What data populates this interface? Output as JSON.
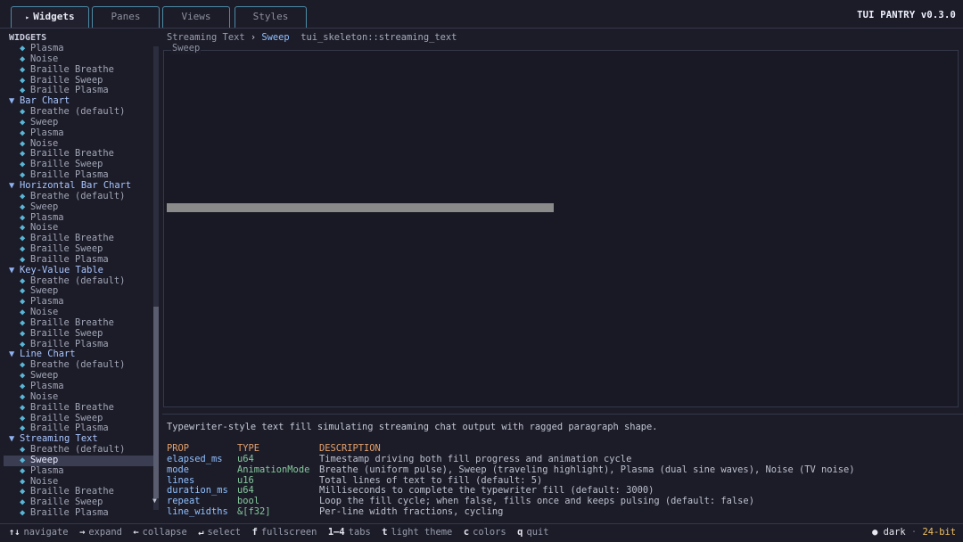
{
  "app": {
    "brand": "TUI PANTRY v0.3.0"
  },
  "tabs": [
    {
      "label": "Widgets",
      "active": true,
      "arrow": "▸"
    },
    {
      "label": "Panes",
      "active": false
    },
    {
      "label": "Views",
      "active": false
    },
    {
      "label": "Styles",
      "active": false
    }
  ],
  "sidebar": {
    "title": "WIDGETS",
    "rows": [
      {
        "kind": "item",
        "label": "Plasma"
      },
      {
        "kind": "item",
        "label": "Noise"
      },
      {
        "kind": "item",
        "label": "Braille Breathe"
      },
      {
        "kind": "item",
        "label": "Braille Sweep"
      },
      {
        "kind": "item",
        "label": "Braille Plasma"
      },
      {
        "kind": "group",
        "label": "Bar Chart"
      },
      {
        "kind": "item",
        "label": "Breathe (default)"
      },
      {
        "kind": "item",
        "label": "Sweep"
      },
      {
        "kind": "item",
        "label": "Plasma"
      },
      {
        "kind": "item",
        "label": "Noise"
      },
      {
        "kind": "item",
        "label": "Braille Breathe"
      },
      {
        "kind": "item",
        "label": "Braille Sweep"
      },
      {
        "kind": "item",
        "label": "Braille Plasma"
      },
      {
        "kind": "group",
        "label": "Horizontal Bar Chart"
      },
      {
        "kind": "item",
        "label": "Breathe (default)"
      },
      {
        "kind": "item",
        "label": "Sweep"
      },
      {
        "kind": "item",
        "label": "Plasma"
      },
      {
        "kind": "item",
        "label": "Noise"
      },
      {
        "kind": "item",
        "label": "Braille Breathe"
      },
      {
        "kind": "item",
        "label": "Braille Sweep"
      },
      {
        "kind": "item",
        "label": "Braille Plasma"
      },
      {
        "kind": "group",
        "label": "Key-Value Table"
      },
      {
        "kind": "item",
        "label": "Breathe (default)"
      },
      {
        "kind": "item",
        "label": "Sweep"
      },
      {
        "kind": "item",
        "label": "Plasma"
      },
      {
        "kind": "item",
        "label": "Noise"
      },
      {
        "kind": "item",
        "label": "Braille Breathe"
      },
      {
        "kind": "item",
        "label": "Braille Sweep"
      },
      {
        "kind": "item",
        "label": "Braille Plasma"
      },
      {
        "kind": "group",
        "label": "Line Chart"
      },
      {
        "kind": "item",
        "label": "Breathe (default)"
      },
      {
        "kind": "item",
        "label": "Sweep"
      },
      {
        "kind": "item",
        "label": "Plasma"
      },
      {
        "kind": "item",
        "label": "Noise"
      },
      {
        "kind": "item",
        "label": "Braille Breathe"
      },
      {
        "kind": "item",
        "label": "Braille Sweep"
      },
      {
        "kind": "item",
        "label": "Braille Plasma"
      },
      {
        "kind": "group",
        "label": "Streaming Text"
      },
      {
        "kind": "item",
        "label": "Breathe (default)"
      },
      {
        "kind": "item",
        "label": "Sweep",
        "selected": true
      },
      {
        "kind": "item",
        "label": "Plasma"
      },
      {
        "kind": "item",
        "label": "Noise"
      },
      {
        "kind": "item",
        "label": "Braille Breathe"
      },
      {
        "kind": "item",
        "label": "Braille Sweep"
      },
      {
        "kind": "item",
        "label": "Braille Plasma"
      }
    ],
    "group_glyph": "▼",
    "item_glyph": "◆",
    "scroll_down_glyph": "▼"
  },
  "breadcrumb": {
    "parent": "Streaming Text",
    "separator": "›",
    "current": "Sweep",
    "path": "tui_skeleton::streaming_text"
  },
  "preview": {
    "label": "Sweep",
    "sweep_progress": 0.49
  },
  "description": "Typewriter-style text fill simulating streaming chat output with ragged paragraph shape.",
  "props": {
    "headers": [
      "PROP",
      "TYPE",
      "DESCRIPTION"
    ],
    "rows": [
      {
        "name": "elapsed_ms",
        "type": "u64",
        "desc": "Timestamp driving both fill progress and animation cycle"
      },
      {
        "name": "mode",
        "type": "AnimationMode",
        "desc": "Breathe (uniform pulse), Sweep (traveling highlight), Plasma (dual sine waves), Noise (TV noise)"
      },
      {
        "name": "lines",
        "type": "u16",
        "desc": "Total lines of text to fill (default: 5)"
      },
      {
        "name": "duration_ms",
        "type": "u64",
        "desc": "Milliseconds to complete the typewriter fill (default: 3000)"
      },
      {
        "name": "repeat",
        "type": "bool",
        "desc": "Loop the fill cycle; when false, fills once and keeps pulsing (default: false)"
      },
      {
        "name": "line_widths",
        "type": "&[f32]",
        "desc": "Per-line width fractions, cycling"
      }
    ]
  },
  "statusbar": {
    "hints": [
      {
        "key": "↑↓",
        "action": "navigate"
      },
      {
        "key": "→",
        "action": "expand"
      },
      {
        "key": "←",
        "action": "collapse"
      },
      {
        "key": "↵",
        "action": "select"
      },
      {
        "key": "f",
        "action": "fullscreen"
      },
      {
        "key": "1–4",
        "action": "tabs"
      },
      {
        "key": "t",
        "action": "light theme"
      },
      {
        "key": "c",
        "action": "colors"
      },
      {
        "key": "q",
        "action": "quit"
      }
    ],
    "theme_dot": "●",
    "theme": "dark",
    "divider": "·",
    "color_depth": "24-bit"
  },
  "colors": {
    "background": "#1c1c29",
    "accent_blue": "#8fc0ff",
    "tab_border": "#4d8aa5",
    "header_orange": "#e3a06a",
    "type_green": "#85c89c",
    "bits_yellow": "#f0c060",
    "selected_row": "#3b3d52",
    "sweep_bar": "#8a8a8a"
  }
}
